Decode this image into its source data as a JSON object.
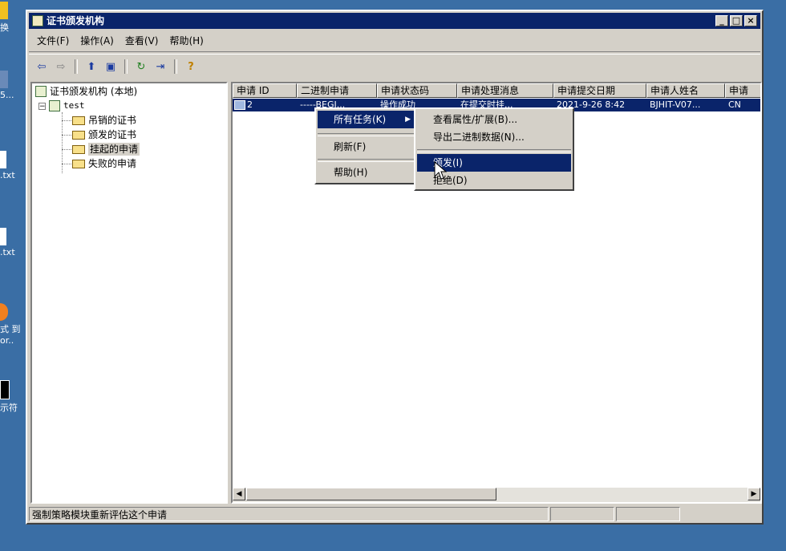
{
  "desktop": {
    "icons": [
      {
        "label": "换",
        "color": "#f0c020"
      },
      {
        "label": "5...",
        "color": "#6a8ab8"
      },
      {
        "label": ".txt",
        "color": "#ffffff"
      },
      {
        "label": ".txt",
        "color": "#ffffff"
      },
      {
        "label": "式 到",
        "sub": "or..",
        "color": "#f08020"
      },
      {
        "label": "示符",
        "color": "#000000"
      }
    ]
  },
  "window": {
    "title": "证书颁发机构",
    "controls": {
      "minimize": "_",
      "maximize": "□",
      "close": "×"
    }
  },
  "menubar": {
    "items": [
      "文件(F)",
      "操作(A)",
      "查看(V)",
      "帮助(H)"
    ]
  },
  "toolbar": {
    "buttons": [
      {
        "icon": "back-icon",
        "glyph": "⇦"
      },
      {
        "icon": "forward-icon",
        "glyph": "⇨"
      },
      {
        "icon": "up-icon",
        "glyph": "⬆"
      },
      {
        "icon": "show-tree-icon",
        "glyph": "▣"
      },
      {
        "icon": "refresh-icon",
        "glyph": "↻"
      },
      {
        "icon": "export-icon",
        "glyph": "⇥"
      },
      {
        "icon": "help-icon",
        "glyph": "?"
      }
    ]
  },
  "tree": {
    "root": "证书颁发机构 (本地)",
    "ca": "test",
    "expander": "−",
    "children": [
      "吊销的证书",
      "颁发的证书",
      "挂起的申请",
      "失败的申请"
    ],
    "selected_index": 2
  },
  "list": {
    "columns": [
      "申请 ID",
      "二进制申请",
      "申请状态码",
      "申请处理消息",
      "申请提交日期",
      "申请人姓名",
      "申请"
    ],
    "rows": [
      [
        "2",
        "-----BEGI...",
        "操作成功",
        "在提交时挂...",
        "2021-9-26 8:42",
        "BJHIT-V07...",
        "CN"
      ]
    ]
  },
  "context_menu": {
    "items": [
      "所有任务(K)",
      "刷新(F)",
      "帮助(H)"
    ]
  },
  "submenu": {
    "items": [
      "查看属性/扩展(B)...",
      "导出二进制数据(N)...",
      "颁发(I)",
      "拒绝(D)"
    ],
    "highlighted": "颁发(I)"
  },
  "status": {
    "text": "强制策略模块重新评估这个申请",
    "fields": [
      "",
      ""
    ]
  }
}
